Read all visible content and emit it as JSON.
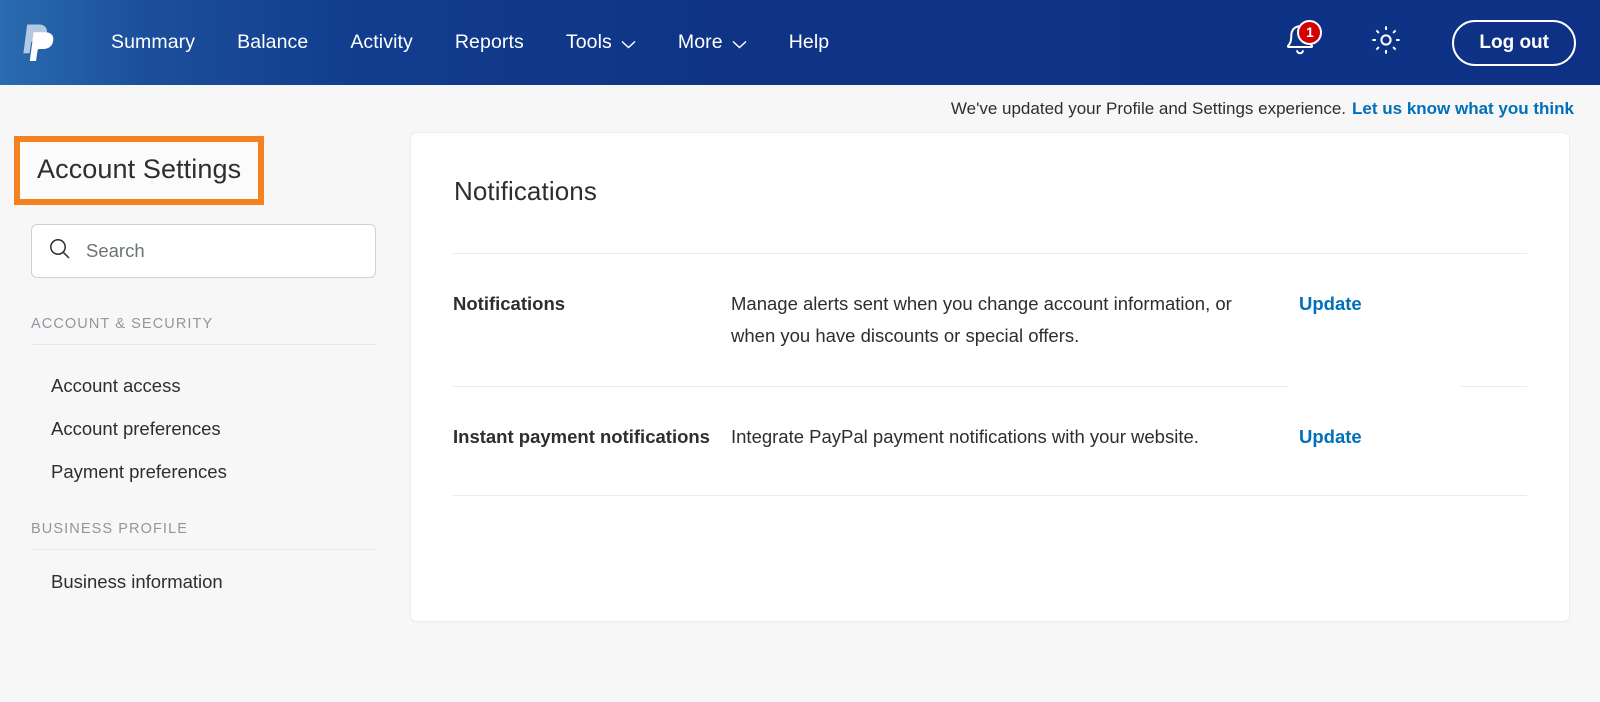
{
  "header": {
    "logo_icon": "paypal-logo-icon",
    "nav": [
      {
        "label": "Summary",
        "has_caret": false
      },
      {
        "label": "Balance",
        "has_caret": false
      },
      {
        "label": "Activity",
        "has_caret": false
      },
      {
        "label": "Reports",
        "has_caret": false
      },
      {
        "label": "Tools",
        "has_caret": true
      },
      {
        "label": "More",
        "has_caret": true
      },
      {
        "label": "Help",
        "has_caret": false
      }
    ],
    "notifications": {
      "icon": "bell-icon",
      "badge_count": "1",
      "badge_color": "#d20000"
    },
    "settings_icon": "gear-icon",
    "logout_label": "Log out",
    "background_start": "#2a6cb0",
    "background_end": "#0e3186"
  },
  "banner": {
    "text": "We've updated your Profile and Settings experience.",
    "link_label": "Let us know what you think",
    "link_color": "#0070ba"
  },
  "sidebar": {
    "title": "Account Settings",
    "title_highlight_color": "#f58220",
    "search": {
      "icon": "search-icon",
      "placeholder": "Search",
      "value": ""
    },
    "groups": [
      {
        "label": "ACCOUNT & SECURITY",
        "items": [
          {
            "label": "Account access"
          },
          {
            "label": "Account preferences"
          },
          {
            "label": "Payment preferences"
          }
        ]
      },
      {
        "label": "BUSINESS PROFILE",
        "items": [
          {
            "label": "Business information"
          }
        ]
      }
    ]
  },
  "main": {
    "card_title": "Notifications",
    "rows": [
      {
        "label": "Notifications",
        "description": "Manage alerts sent when you change account information, or when you have discounts or special offers.",
        "action_label": "Update"
      },
      {
        "label": "Instant payment notifications",
        "description": "Integrate PayPal payment notifications with your website.",
        "action_label": "Update"
      }
    ],
    "link_color": "#0070ba"
  }
}
